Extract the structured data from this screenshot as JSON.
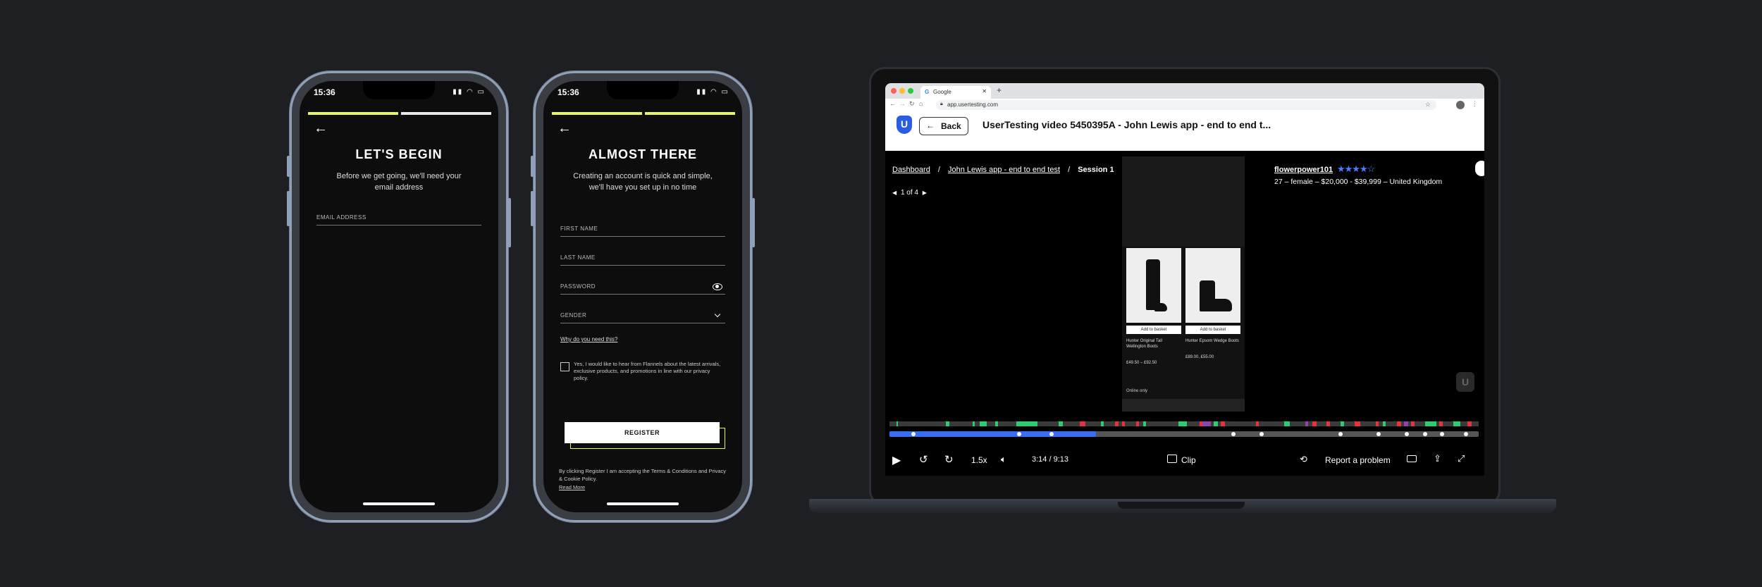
{
  "phone1": {
    "time": "15:36",
    "status_icons": "▮▮ ◠ ▭",
    "title": "LET'S BEGIN",
    "subtitle": "Before we get going, we'll need your email address",
    "email_label": "EMAIL ADDRESS"
  },
  "phone2": {
    "time": "15:36",
    "status_icons": "▮▮ ◠ ▭",
    "title": "ALMOST THERE",
    "subtitle": "Creating an account is quick and simple, we'll have you set up in no time",
    "first_name_label": "FIRST NAME",
    "last_name_label": "LAST NAME",
    "password_label": "PASSWORD",
    "gender_label": "GENDER",
    "why_link": "Why do you need this?",
    "marketing_text": "Yes, I would like to hear from Flannels about the latest arrivals, exclusive products, and promotions in line with our privacy policy.",
    "register_label": "REGISTER",
    "terms_text": "By clicking Register I am accepting the Terms & Conditions and Privacy & Cookie Policy.",
    "read_more": "Read More"
  },
  "browser": {
    "tab_title": "Google",
    "url": "app.usertesting.com",
    "logo_letter": "U",
    "back_label": "Back",
    "video_title": "UserTesting video 5450395A - John Lewis app - end to end t...",
    "breadcrumb": [
      "Dashboard",
      "John Lewis app - end to end test",
      "Session 1"
    ],
    "pager": "1 of 4",
    "user_name": "flowerpower101",
    "rating_stars": "★★★★☆",
    "user_meta": "27 – female – $20,000 - $39,999 – United Kingdom",
    "watermark": "U",
    "controls": {
      "speed": "1.5x",
      "time": "3:14 / 9:13",
      "clip": "Clip",
      "report": "Report a problem"
    },
    "progress_fraction": 0.35,
    "colors": {
      "accent": "#2b5ce6",
      "progress": "#3a6df0",
      "phone_accent": "#e7f36b"
    }
  },
  "mobile_shot": {
    "product1": "Hunter Original Tall Wellington Boots",
    "price1": "£49.50 – £92.50",
    "product2": "Hunter Epsom Wedge Boots",
    "price2": "£89.00, £55.00",
    "add_to_basket": "Add to basket",
    "online_only": "Online only"
  }
}
